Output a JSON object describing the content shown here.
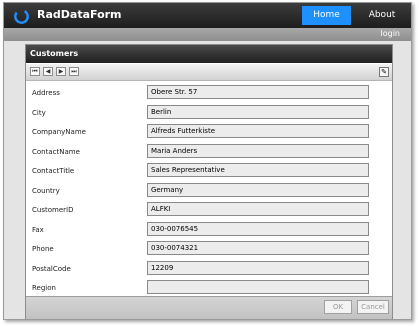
{
  "app": {
    "title": "RadDataForm",
    "accent_color": "#1e90ff"
  },
  "nav": {
    "home_label": "Home",
    "about_label": "About",
    "login_label": "login"
  },
  "form": {
    "title": "Customers",
    "fields": [
      {
        "label": "Address",
        "value": "Obere Str. 57"
      },
      {
        "label": "City",
        "value": "Berlin"
      },
      {
        "label": "CompanyName",
        "value": "Alfreds Futterkiste"
      },
      {
        "label": "ContactName",
        "value": "Maria Anders"
      },
      {
        "label": "ContactTitle",
        "value": "Sales Representative"
      },
      {
        "label": "Country",
        "value": "Germany"
      },
      {
        "label": "CustomerID",
        "value": "ALFKI"
      },
      {
        "label": "Fax",
        "value": "030-0076545"
      },
      {
        "label": "Phone",
        "value": "030-0074321"
      },
      {
        "label": "PostalCode",
        "value": "12209"
      },
      {
        "label": "Region",
        "value": ""
      }
    ],
    "toolbar": {
      "nav_icons": [
        "first-record-icon",
        "previous-record-icon",
        "next-record-icon",
        "last-record-icon"
      ],
      "edit_icon": "pencil-icon"
    },
    "ok_label": "OK",
    "cancel_label": "Cancel"
  }
}
